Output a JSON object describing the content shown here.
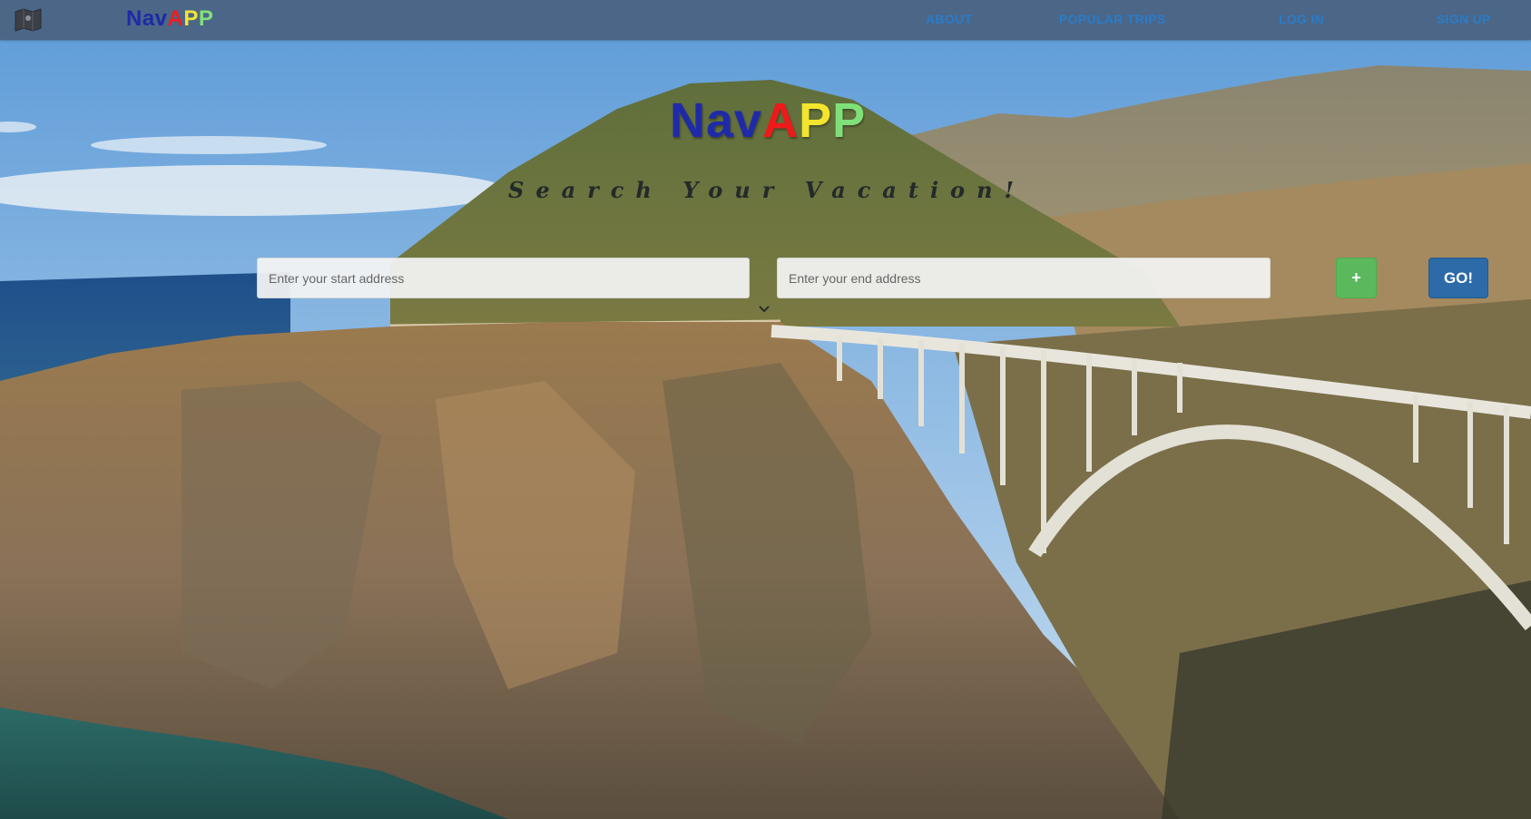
{
  "navbar": {
    "brand": {
      "part1": "Nav",
      "part2": "A",
      "part3": "P",
      "part4": "P"
    },
    "links": [
      {
        "label": "ABOUT"
      },
      {
        "label": "POPULAR TRIPS"
      },
      {
        "label": "LOG IN"
      },
      {
        "label": "SIGN UP"
      }
    ],
    "icon": "map-icon"
  },
  "hero": {
    "logo": {
      "part1": "Nav",
      "part2": "A",
      "part3": "P",
      "part4": "P"
    },
    "tagline": "Search Your Vacation!",
    "start_input": {
      "placeholder": "Enter your start address",
      "value": ""
    },
    "end_input": {
      "placeholder": "Enter your end address",
      "value": ""
    },
    "add_button_label": "+",
    "go_button_label": "GO!",
    "scroll_icon": "chevron-down-icon"
  },
  "colors": {
    "navbar_bg": "#4a6280",
    "nav_link": "#2a7cc8",
    "brand_blue": "#1d2aa6",
    "brand_red": "#ef1e1e",
    "brand_yellow": "#f2e433",
    "brand_green": "#82e07a",
    "add_button": "#5cb85c",
    "go_button": "#2c6aa8"
  }
}
